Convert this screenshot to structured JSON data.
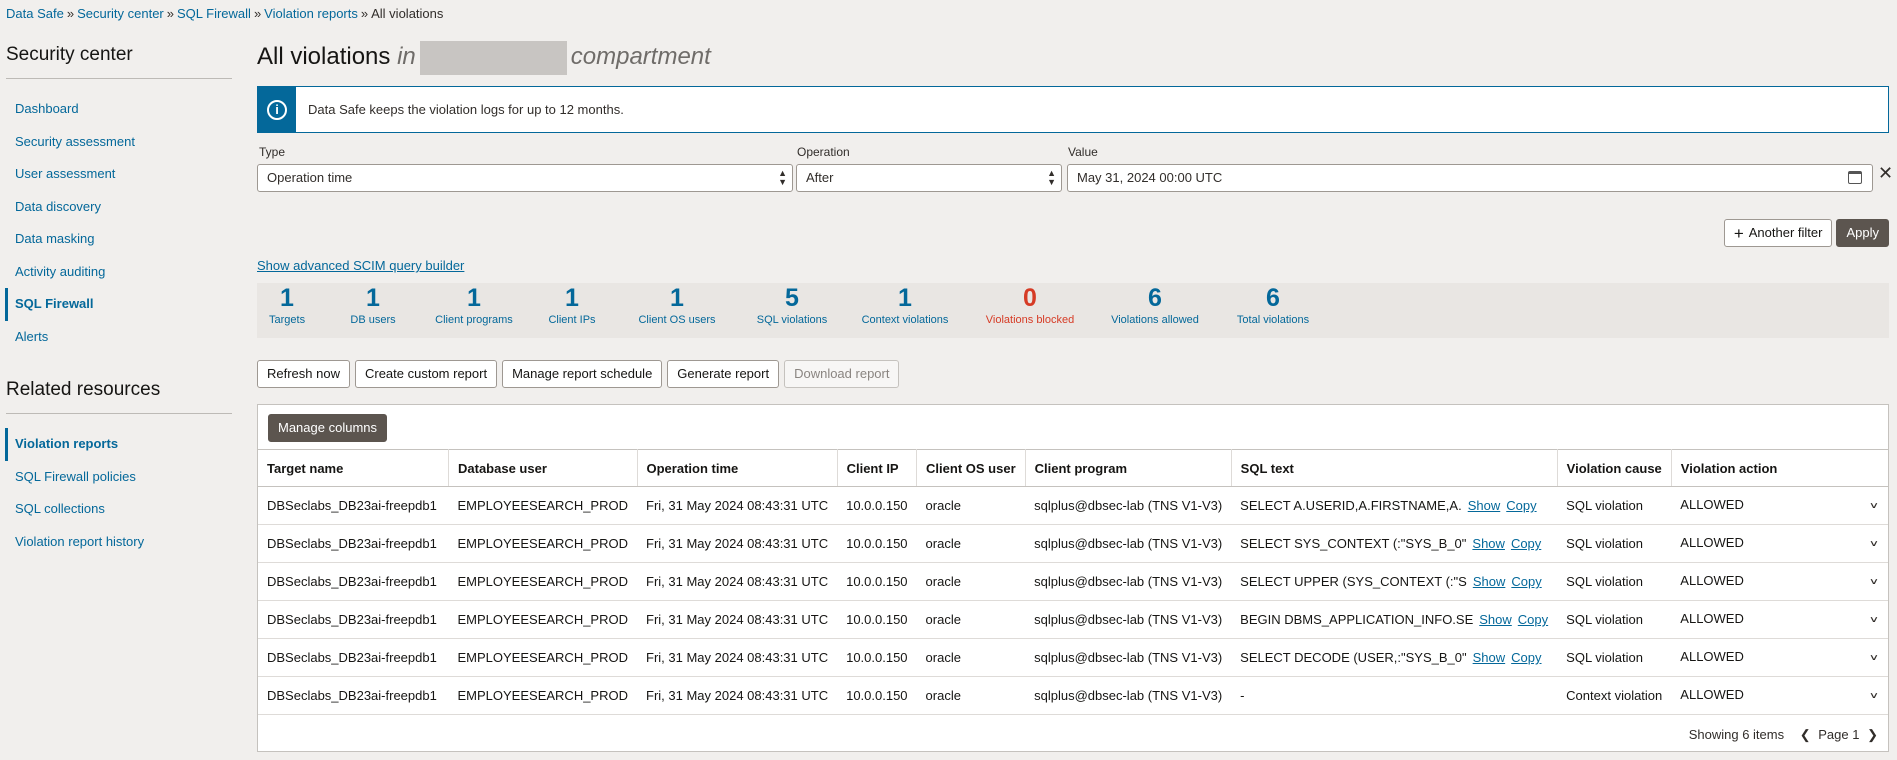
{
  "breadcrumb": {
    "items": [
      "Data Safe",
      "Security center",
      "SQL Firewall",
      "Violation reports"
    ],
    "current": "All violations",
    "separator": "»"
  },
  "sidebar": {
    "heading": "Security center",
    "items": [
      {
        "label": "Dashboard"
      },
      {
        "label": "Security assessment"
      },
      {
        "label": "User assessment"
      },
      {
        "label": "Data discovery"
      },
      {
        "label": "Data masking"
      },
      {
        "label": "Activity auditing"
      },
      {
        "label": "SQL Firewall"
      },
      {
        "label": "Alerts"
      }
    ],
    "related_heading": "Related resources",
    "related_items": [
      {
        "label": "Violation reports"
      },
      {
        "label": "SQL Firewall policies"
      },
      {
        "label": "SQL collections"
      },
      {
        "label": "Violation report history"
      }
    ]
  },
  "page": {
    "title": "All violations",
    "in": "in",
    "compartment": "compartment",
    "info_icon": "i",
    "info_message": "Data Safe keeps the violation logs for up to 12 months."
  },
  "filters": {
    "type_label": "Type",
    "type_value": "Operation time",
    "operation_label": "Operation",
    "operation_value": "After",
    "value_label": "Value",
    "value_value": "May 31, 2024 00:00 UTC",
    "close_glyph": "✕",
    "another_filter": "Another filter",
    "apply": "Apply",
    "scim_link": "Show advanced SCIM query builder"
  },
  "stats": [
    {
      "num": "1",
      "label": "Targets"
    },
    {
      "num": "1",
      "label": "DB users"
    },
    {
      "num": "1",
      "label": "Client programs"
    },
    {
      "num": "1",
      "label": "Client IPs"
    },
    {
      "num": "1",
      "label": "Client OS users"
    },
    {
      "num": "5",
      "label": "SQL violations"
    },
    {
      "num": "1",
      "label": "Context violations"
    },
    {
      "num": "0",
      "label": "Violations blocked"
    },
    {
      "num": "6",
      "label": "Violations allowed"
    },
    {
      "num": "6",
      "label": "Total violations"
    }
  ],
  "actions": {
    "refresh": "Refresh now",
    "custom": "Create custom report",
    "schedule": "Manage report schedule",
    "generate": "Generate report",
    "download": "Download report"
  },
  "table": {
    "manage_columns": "Manage columns",
    "columns": [
      "Target name",
      "Database user",
      "Operation time",
      "Client IP",
      "Client OS user",
      "Client program",
      "SQL text",
      "Violation cause",
      "Violation action"
    ],
    "show_label": "Show",
    "copy_label": "Copy",
    "rows": [
      {
        "target": "DBSeclabs_DB23ai-freepdb1",
        "dbuser": "EMPLOYEESEARCH_PROD",
        "time": "Fri, 31 May 2024 08:43:31 UTC",
        "ip": "10.0.0.150",
        "osuser": "oracle",
        "program": "sqlplus@dbsec-lab (TNS V1-V3)",
        "sql": "SELECT A.USERID,A.FIRSTNAME,A.",
        "cause": "SQL violation",
        "action": "ALLOWED"
      },
      {
        "target": "DBSeclabs_DB23ai-freepdb1",
        "dbuser": "EMPLOYEESEARCH_PROD",
        "time": "Fri, 31 May 2024 08:43:31 UTC",
        "ip": "10.0.0.150",
        "osuser": "oracle",
        "program": "sqlplus@dbsec-lab (TNS V1-V3)",
        "sql": "SELECT SYS_CONTEXT (:\"SYS_B_0\"",
        "cause": "SQL violation",
        "action": "ALLOWED"
      },
      {
        "target": "DBSeclabs_DB23ai-freepdb1",
        "dbuser": "EMPLOYEESEARCH_PROD",
        "time": "Fri, 31 May 2024 08:43:31 UTC",
        "ip": "10.0.0.150",
        "osuser": "oracle",
        "program": "sqlplus@dbsec-lab (TNS V1-V3)",
        "sql": "SELECT UPPER (SYS_CONTEXT (:\"S",
        "cause": "SQL violation",
        "action": "ALLOWED"
      },
      {
        "target": "DBSeclabs_DB23ai-freepdb1",
        "dbuser": "EMPLOYEESEARCH_PROD",
        "time": "Fri, 31 May 2024 08:43:31 UTC",
        "ip": "10.0.0.150",
        "osuser": "oracle",
        "program": "sqlplus@dbsec-lab (TNS V1-V3)",
        "sql": "BEGIN DBMS_APPLICATION_INFO.SE",
        "cause": "SQL violation",
        "action": "ALLOWED"
      },
      {
        "target": "DBSeclabs_DB23ai-freepdb1",
        "dbuser": "EMPLOYEESEARCH_PROD",
        "time": "Fri, 31 May 2024 08:43:31 UTC",
        "ip": "10.0.0.150",
        "osuser": "oracle",
        "program": "sqlplus@dbsec-lab (TNS V1-V3)",
        "sql": "SELECT DECODE (USER,:\"SYS_B_0\"",
        "cause": "SQL violation",
        "action": "ALLOWED"
      },
      {
        "target": "DBSeclabs_DB23ai-freepdb1",
        "dbuser": "EMPLOYEESEARCH_PROD",
        "time": "Fri, 31 May 2024 08:43:31 UTC",
        "ip": "10.0.0.150",
        "osuser": "oracle",
        "program": "sqlplus@dbsec-lab (TNS V1-V3)",
        "sql": "-",
        "cause": "Context violation",
        "action": "ALLOWED"
      }
    ],
    "showing": "Showing 6 items",
    "page": "Page 1"
  },
  "colors": {
    "link": "#04689a",
    "blocked": "#d63b25",
    "dark_button": "#5c554f"
  }
}
